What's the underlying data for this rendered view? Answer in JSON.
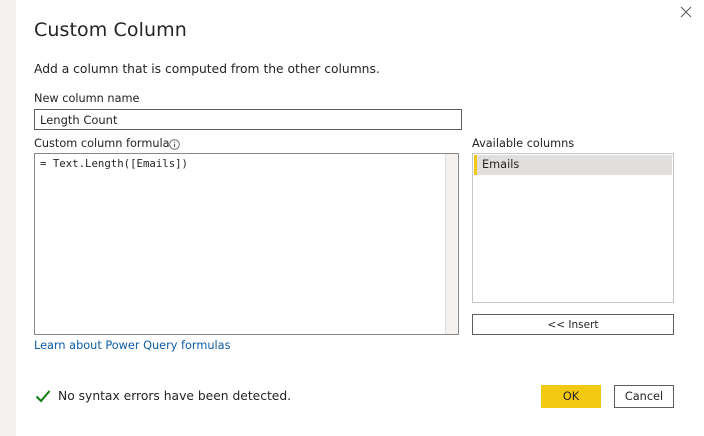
{
  "dialog": {
    "title": "Custom Column",
    "subtitle": "Add a column that is computed from the other columns.",
    "close_icon": "close-icon"
  },
  "new_column": {
    "label": "New column name",
    "value": "Length Count"
  },
  "formula": {
    "label": "Custom column formula",
    "info_icon": "info-icon",
    "text": "= Text.Length([Emails])"
  },
  "available_columns": {
    "label": "Available columns",
    "items": [
      "Emails"
    ],
    "insert_label": "<< Insert"
  },
  "learn_link": "Learn about Power Query formulas",
  "status": {
    "icon": "checkmark-icon",
    "text": "No syntax errors have been detected."
  },
  "buttons": {
    "ok": "OK",
    "cancel": "Cancel"
  },
  "colors": {
    "accent": "#f2c811",
    "link": "#0e5ca4",
    "success": "#107c10",
    "selection": "#e1dfdd"
  }
}
